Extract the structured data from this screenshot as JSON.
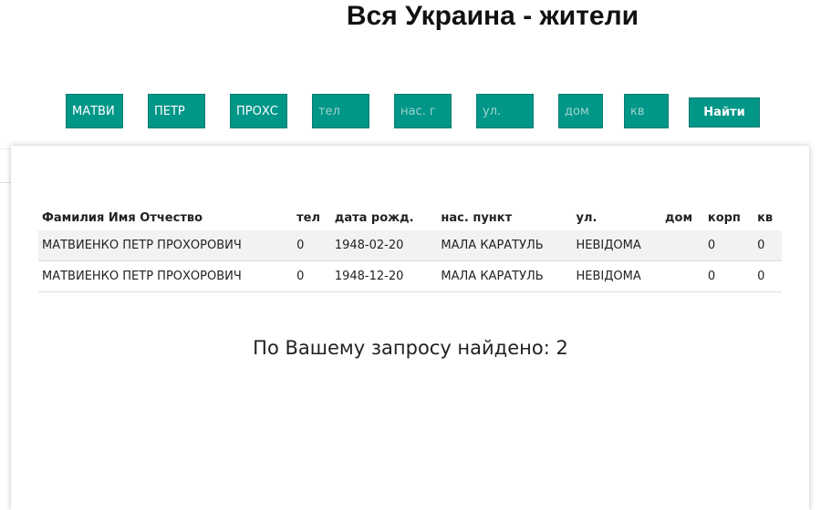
{
  "title": "Вся Украина - жители",
  "search": {
    "fields": [
      {
        "name": "surname",
        "value": "МАТВИ",
        "placeholder": ""
      },
      {
        "name": "first-name",
        "value": "ПЕТР",
        "placeholder": ""
      },
      {
        "name": "patronymic",
        "value": "ПРОХС",
        "placeholder": ""
      },
      {
        "name": "phone",
        "value": "",
        "placeholder": "тел"
      },
      {
        "name": "locality",
        "value": "",
        "placeholder": "нас. г"
      },
      {
        "name": "street",
        "value": "",
        "placeholder": "ул."
      },
      {
        "name": "house",
        "value": "",
        "placeholder": "дом"
      },
      {
        "name": "apartment",
        "value": "",
        "placeholder": "кв"
      }
    ],
    "submit_label": "Найти"
  },
  "table": {
    "headers": [
      "Фамилия Имя Отчество",
      "тел",
      "дата рожд.",
      "нас. пункт",
      "ул.",
      "дом",
      "корп",
      "кв"
    ],
    "rows": [
      [
        "МАТВИЕНКО ПЕТР ПРОХОРОВИЧ",
        "0",
        "1948-02-20",
        "МАЛА КАРАТУЛЬ",
        "НЕВІДОМА",
        "",
        "0",
        "0"
      ],
      [
        "МАТВИЕНКО ПЕТР ПРОХОРОВИЧ",
        "0",
        "1948-12-20",
        "МАЛА КАРАТУЛЬ",
        "НЕВІДОМА",
        "",
        "0",
        "0"
      ]
    ]
  },
  "result_text": "По Вашему запросу найдено: 2",
  "colors": {
    "accent": "#009688"
  }
}
